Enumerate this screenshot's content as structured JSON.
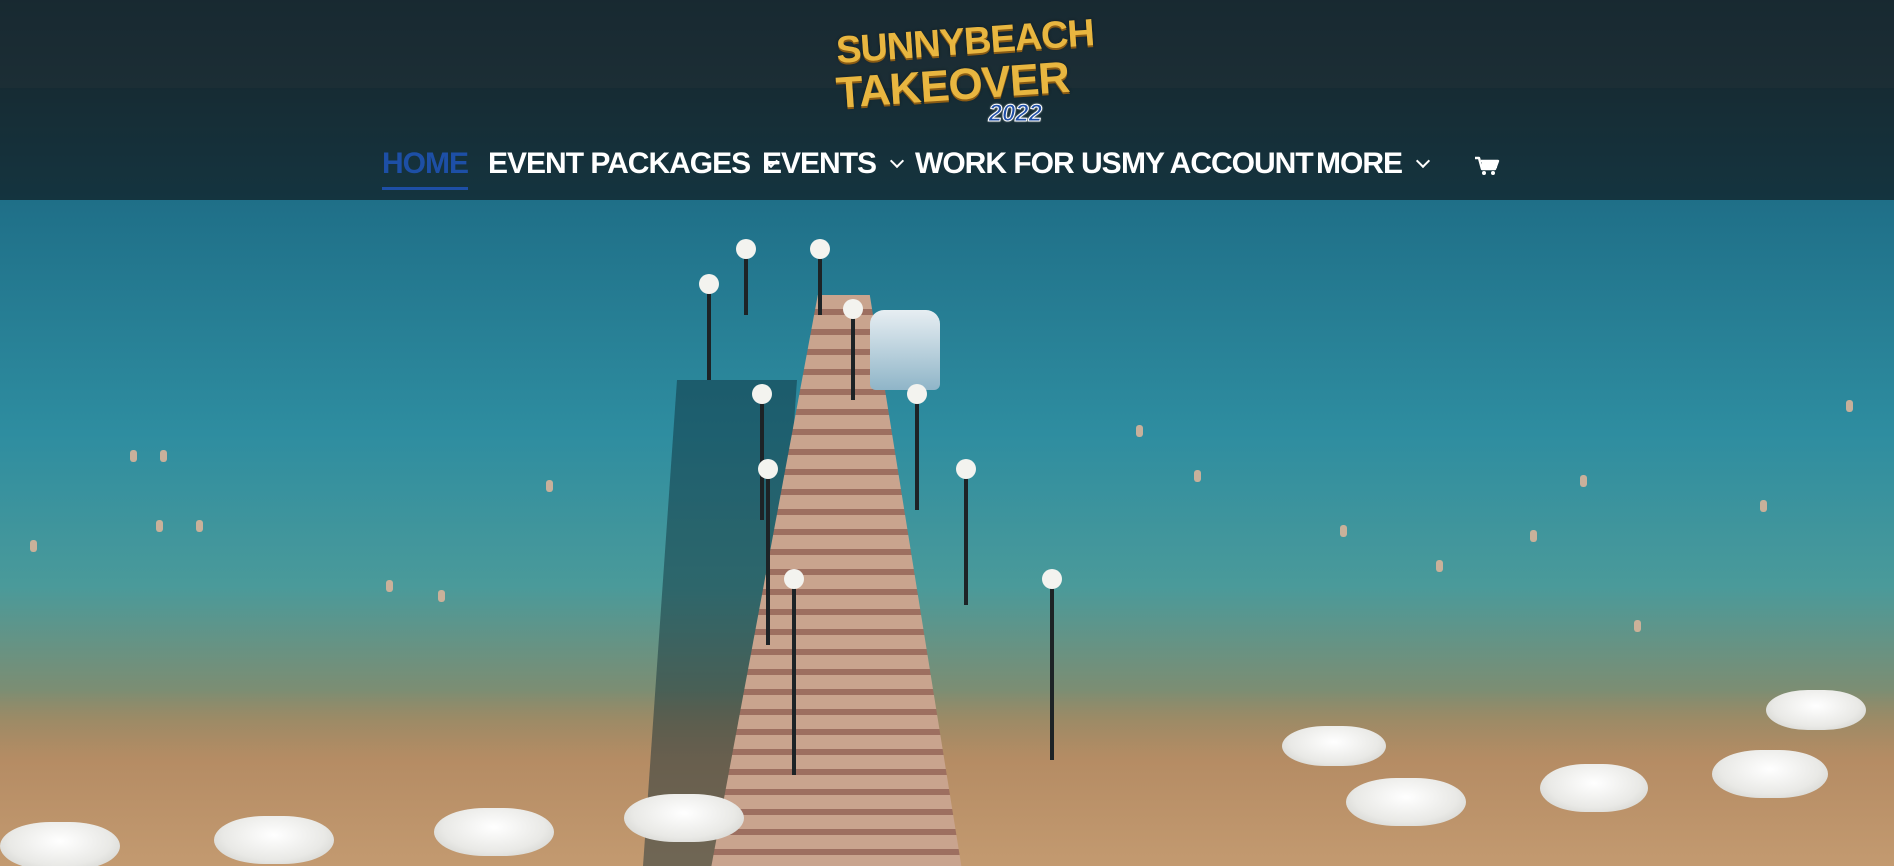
{
  "brand": {
    "line1": "SUNNYBEACH",
    "line2": "TAKEOVER",
    "year": "2022"
  },
  "nav": {
    "home": "HOME",
    "event_packages": "EVENT PACKAGES",
    "events": "EVENTS",
    "work_for_us": "WORK FOR US",
    "my_account": "MY ACCOUNT",
    "more": "MORE"
  },
  "colors": {
    "active_nav": "#1d4fa6",
    "nav_text": "#ffffff",
    "logo_gold": "#e8b640"
  },
  "icons": [
    "chevron-down-icon",
    "cart-icon"
  ]
}
